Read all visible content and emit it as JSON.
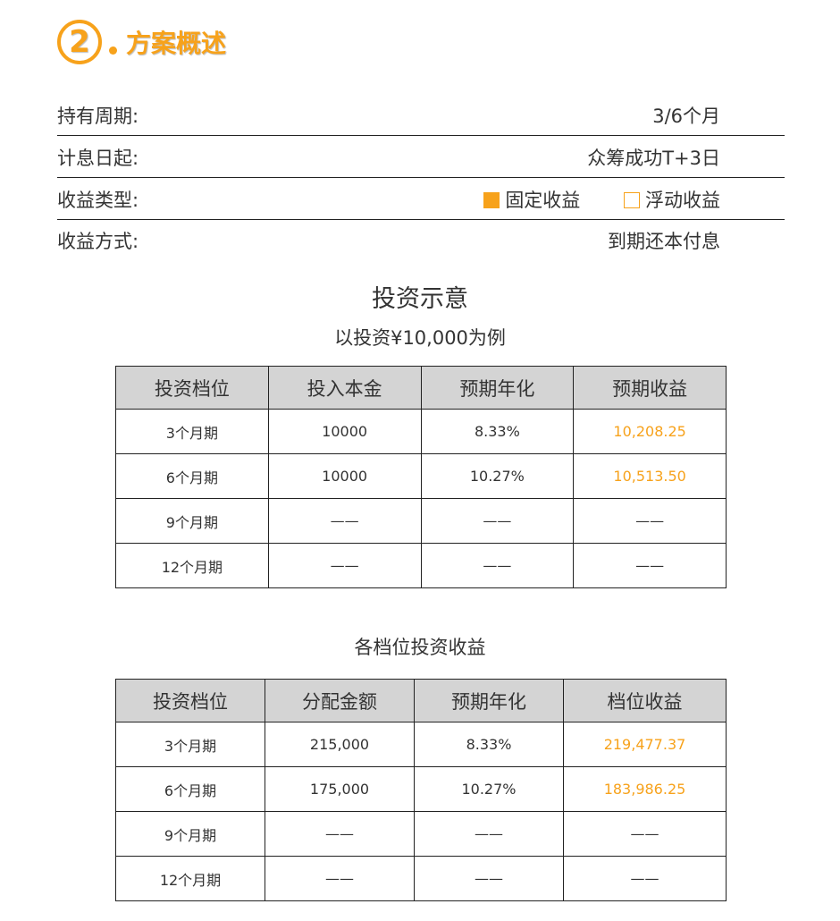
{
  "header": {
    "number": "2",
    "title": "方案概述"
  },
  "info": [
    {
      "label": "持有周期:",
      "value": "3/6个月"
    },
    {
      "label": "计息日起:",
      "value": "众筹成功T+3日"
    },
    {
      "label": "收益类型:",
      "options": [
        {
          "label": "固定收益",
          "checked": true
        },
        {
          "label": "浮动收益",
          "checked": false
        }
      ]
    },
    {
      "label": "收益方式:",
      "value": "到期还本付息"
    }
  ],
  "example": {
    "title": "投资示意",
    "subtitle": "以投资¥10,000为例",
    "headers": [
      "投资档位",
      "投入本金",
      "预期年化",
      "预期收益"
    ],
    "rows": [
      [
        "3个月期",
        "10000",
        "8.33%",
        "10,208.25"
      ],
      [
        "6个月期",
        "10000",
        "10.27%",
        "10,513.50"
      ],
      [
        "9个月期",
        "——",
        "——",
        "——"
      ],
      [
        "12个月期",
        "——",
        "——",
        "——"
      ]
    ]
  },
  "tiers": {
    "title": "各档位投资收益",
    "headers": [
      "投资档位",
      "分配金额",
      "预期年化",
      "档位收益"
    ],
    "rows": [
      [
        "3个月期",
        "215,000",
        "8.33%",
        "219,477.37"
      ],
      [
        "6个月期",
        "175,000",
        "10.27%",
        "183,986.25"
      ],
      [
        "9个月期",
        "——",
        "——",
        "——"
      ],
      [
        "12个月期",
        "——",
        "——",
        "——"
      ]
    ]
  },
  "colors": {
    "accent": "#f7a21b"
  }
}
